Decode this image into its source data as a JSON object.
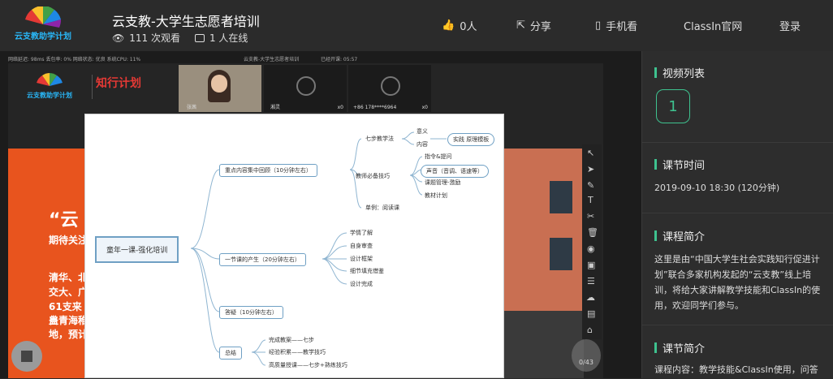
{
  "header": {
    "title": "云支教-大学生志愿者培训",
    "views": "111 次观看",
    "online": "1 人在线",
    "likes": "0人",
    "share": "分享",
    "mobile": "手机看",
    "official": "ClassIn官网",
    "login": "登录",
    "logo_text": "云支教助学计划"
  },
  "classroom": {
    "status": "网络延迟: 98ms 丢包率: 0% 网络状态: 优良 系统CPU: 11%",
    "title": "云支教-大学生志愿者培训",
    "time": "已经开课: 05:57",
    "logo1": "云支教助学计划",
    "logo2": "知行计划",
    "tiles": [
      {
        "name": "张茜",
        "stars": ""
      },
      {
        "name": "湘灵",
        "stars": "x0"
      },
      {
        "name": "+86 178****6964",
        "stars": "x0"
      }
    ],
    "slide_text": [
      "“云",
      "期待关注",
      "清华、北",
      "交大、广",
      "61支来自",
      "盖青海稚",
      "地，预计"
    ],
    "counter": "0/43"
  },
  "mindmap": {
    "root": "童年一课-强化培训",
    "branches": [
      {
        "label": "重点内容集中回顾（10分钟左右）",
        "children": [
          {
            "label": "七步教学法",
            "children": [
              "意义",
              "内容"
            ],
            "note": "实践 原理模板"
          },
          {
            "label": "教师必备技巧",
            "children": [
              "指令&提问",
              "声音（音调、语速等）",
              "课题管理-激励",
              "教材计划"
            ]
          },
          {
            "label": "单例：阅读课",
            "children": []
          }
        ]
      },
      {
        "label": "一节课的产生（20分钟左右）",
        "children": [
          {
            "label": "学情了解"
          },
          {
            "label": "自身审查"
          },
          {
            "label": "设计框架"
          },
          {
            "label": "细节填充借鉴"
          },
          {
            "label": "设计完成"
          }
        ]
      },
      {
        "label": "答疑（10分钟左右）",
        "children": []
      },
      {
        "label": "总结",
        "children": [
          {
            "label": "完成教案——七步"
          },
          {
            "label": "经验积累——教学技巧"
          },
          {
            "label": "高质量授课——七步+熟练技巧"
          }
        ]
      }
    ]
  },
  "sidebar": {
    "video_list_title": "视频列表",
    "video_number": "1",
    "lesson_time_title": "课节时间",
    "lesson_time": "2019-09-10 18:30 (120分钟)",
    "course_intro_title": "课程简介",
    "course_intro": "这里是由“中国大学生社会实践知行促进计划”联合多家机构发起的“云支教”线上培训，将给大家讲解教学技能和ClassIn的使用，欢迎同学们参与。",
    "lesson_intro_title": "课节简介",
    "lesson_intro": "课程内容：教学技能&ClassIn使用，问答"
  },
  "colors": {
    "accent": "#3ec28f",
    "orange": "#e8541e"
  }
}
